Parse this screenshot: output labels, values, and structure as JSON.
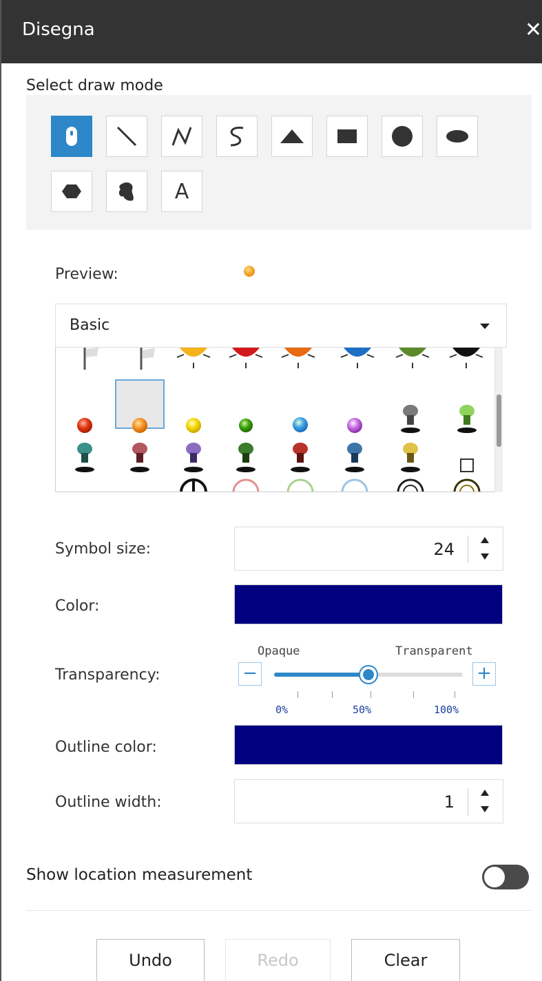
{
  "header": {
    "title": "Disegna",
    "close_label": "✕"
  },
  "draw_mode": {
    "label": "Select draw mode",
    "modes": [
      {
        "name": "point",
        "icon": "mouse-pointer-icon",
        "active": true
      },
      {
        "name": "line",
        "icon": "line-icon"
      },
      {
        "name": "polyline",
        "icon": "polyline-icon"
      },
      {
        "name": "freehand-polyline",
        "icon": "freehand-line-icon"
      },
      {
        "name": "triangle",
        "icon": "triangle-icon"
      },
      {
        "name": "rectangle",
        "icon": "rectangle-icon"
      },
      {
        "name": "circle",
        "icon": "circle-icon"
      },
      {
        "name": "ellipse",
        "icon": "ellipse-icon"
      },
      {
        "name": "polygon",
        "icon": "polygon-icon"
      },
      {
        "name": "freehand-polygon",
        "icon": "freehand-polygon-icon"
      },
      {
        "name": "text",
        "icon": "text-icon",
        "text": "A"
      }
    ]
  },
  "preview": {
    "label": "Preview:"
  },
  "symbol_set": {
    "value": "Basic"
  },
  "symbol_size": {
    "label": "Symbol size:",
    "value": "24"
  },
  "color": {
    "label": "Color:",
    "value": "#000080"
  },
  "transparency": {
    "label": "Transparency:",
    "left_label": "Opaque",
    "right_label": "Transparent",
    "minus": "−",
    "plus": "+",
    "value_percent": 50,
    "ticks": [
      "0%",
      "50%",
      "100%"
    ]
  },
  "outline_color": {
    "label": "Outline color:",
    "value": "#000080"
  },
  "outline_width": {
    "label": "Outline width:",
    "value": "1"
  },
  "location_measurement": {
    "label": "Show location measurement",
    "enabled": false
  },
  "actions": {
    "undo": "Undo",
    "redo": "Redo",
    "clear": "Clear"
  },
  "accent_color": "#2d87c8"
}
